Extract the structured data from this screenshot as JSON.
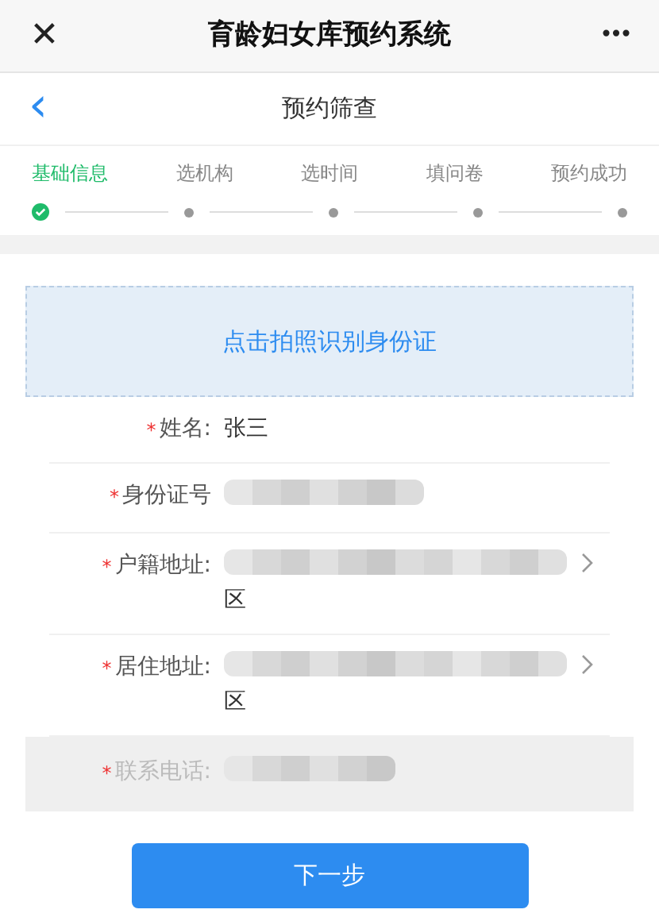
{
  "window": {
    "title": "育龄妇女库预约系统",
    "close": "✕",
    "more": "•••"
  },
  "nav": {
    "back": "‹",
    "title": "预约筛查"
  },
  "steps": [
    {
      "label": "基础信息",
      "selected": true
    },
    {
      "label": "选机构",
      "selected": false
    },
    {
      "label": "选时间",
      "selected": false
    },
    {
      "label": "填问卷",
      "selected": false
    },
    {
      "label": "预约成功",
      "selected": false
    }
  ],
  "id_scan": {
    "label": "点击拍照识别身份证"
  },
  "fields": [
    {
      "kind": "text",
      "required": true,
      "label": "姓名:",
      "value": "张三",
      "disabled": false
    },
    {
      "kind": "masked",
      "required": true,
      "label": "身份证号",
      "disabled": false
    },
    {
      "kind": "address",
      "required": true,
      "label": "户籍地址:",
      "value": "区",
      "disabled": false
    },
    {
      "kind": "address",
      "required": true,
      "label": "居住地址:",
      "value": "区",
      "disabled": false
    },
    {
      "kind": "masked",
      "required": true,
      "label": "联系电话:",
      "disabled": true
    }
  ],
  "required_mark": "*",
  "next_button": "下一步"
}
